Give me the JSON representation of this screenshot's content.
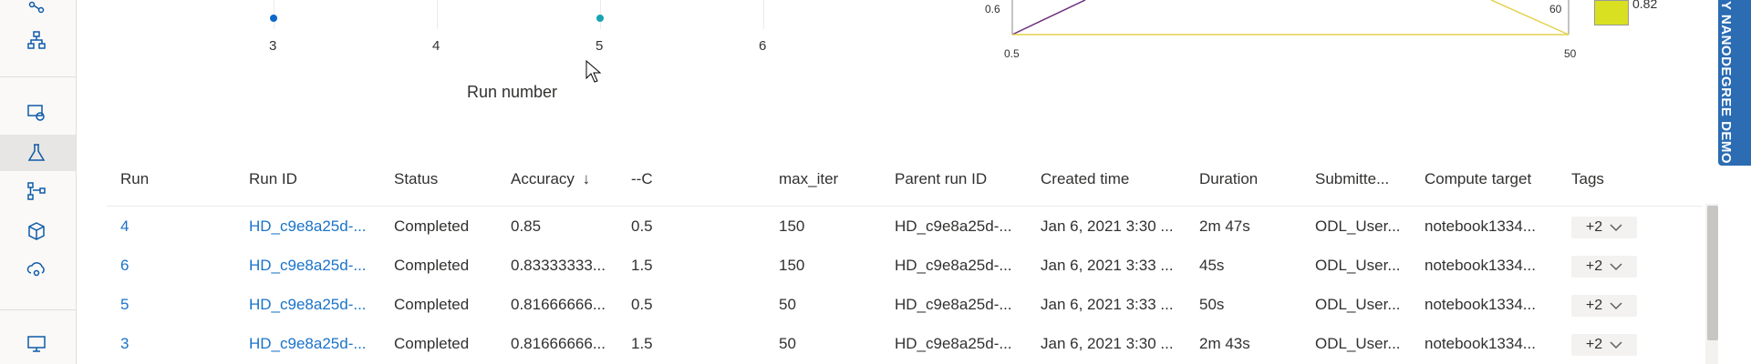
{
  "scatter": {
    "x_ticks": [
      "3",
      "4",
      "5",
      "6"
    ],
    "x_axis_label": "Run number",
    "points": [
      {
        "run": 3,
        "color": "#0b67c9"
      },
      {
        "run": 5,
        "color": "#19a3b5"
      }
    ]
  },
  "parallel": {
    "left_tick": "0.6",
    "mid_tick": "60",
    "bottom_left": "0.5",
    "bottom_right": "50",
    "legend_value": "0.82"
  },
  "banner": {
    "text": "Y NANODEGREE DEMO"
  },
  "table": {
    "headers": [
      "Run",
      "Run ID",
      "Status",
      "Accuracy",
      "--C",
      "max_iter",
      "Parent run ID",
      "Created time",
      "Duration",
      "Submitte...",
      "Compute target",
      "Tags"
    ],
    "sort_indicator": "↓",
    "rows": [
      {
        "run": "4",
        "run_id": "HD_c9e8a25d-...",
        "status": "Completed",
        "accuracy": "0.85",
        "c": "0.5",
        "max_iter": "150",
        "parent": "HD_c9e8a25d-...",
        "created": "Jan 6, 2021 3:30 ...",
        "duration": "2m 47s",
        "submitted": "ODL_User...",
        "compute": "notebook1334...",
        "tags": "+2"
      },
      {
        "run": "6",
        "run_id": "HD_c9e8a25d-...",
        "status": "Completed",
        "accuracy": "0.83333333...",
        "c": "1.5",
        "max_iter": "150",
        "parent": "HD_c9e8a25d-...",
        "created": "Jan 6, 2021 3:33 ...",
        "duration": "45s",
        "submitted": "ODL_User...",
        "compute": "notebook1334...",
        "tags": "+2"
      },
      {
        "run": "5",
        "run_id": "HD_c9e8a25d-...",
        "status": "Completed",
        "accuracy": "0.81666666...",
        "c": "0.5",
        "max_iter": "50",
        "parent": "HD_c9e8a25d-...",
        "created": "Jan 6, 2021 3:33 ...",
        "duration": "50s",
        "submitted": "ODL_User...",
        "compute": "notebook1334...",
        "tags": "+2"
      },
      {
        "run": "3",
        "run_id": "HD_c9e8a25d-...",
        "status": "Completed",
        "accuracy": "0.81666666...",
        "c": "1.5",
        "max_iter": "50",
        "parent": "HD_c9e8a25d-...",
        "created": "Jan 6, 2021 3:30 ...",
        "duration": "2m 43s",
        "submitted": "ODL_User...",
        "compute": "notebook1334...",
        "tags": "+2"
      }
    ]
  },
  "colors": {
    "link": "#1a73c9",
    "banner": "#2b6cb3",
    "legend_yellow": "#d9e021"
  }
}
